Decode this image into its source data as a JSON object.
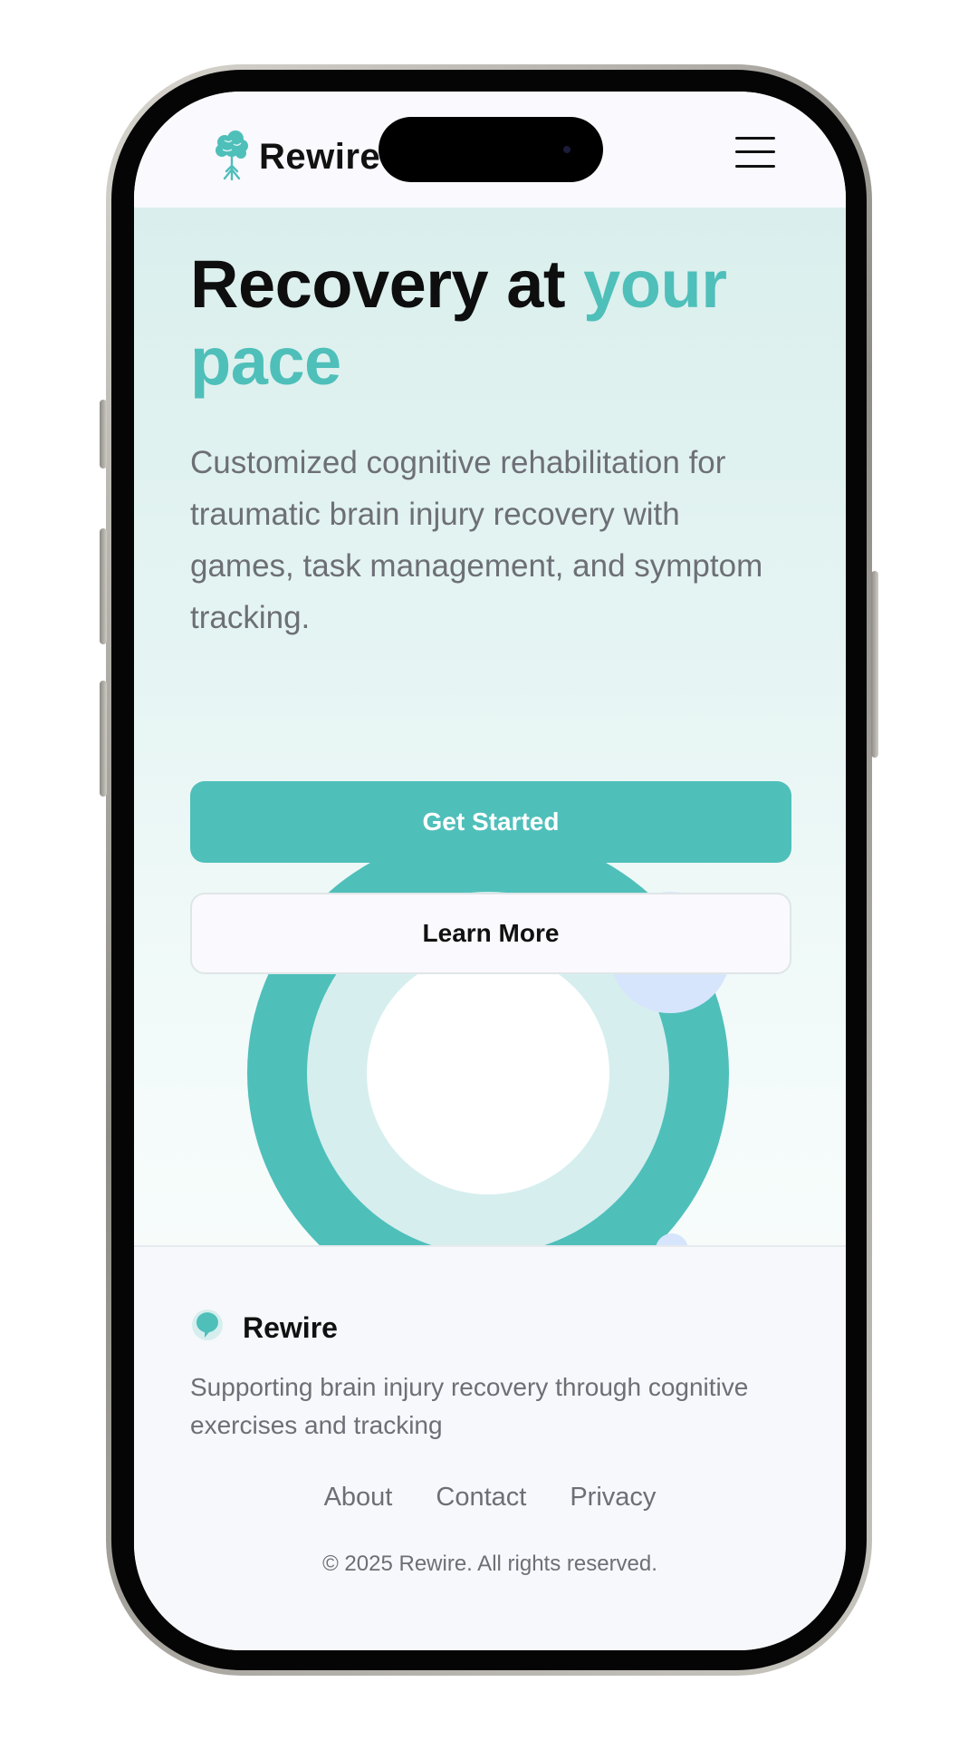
{
  "header": {
    "logo_text": "Rewire",
    "logo_icon": "brain-tree-icon",
    "menu_icon": "hamburger-menu-icon"
  },
  "hero": {
    "title_part1": "Recovery at ",
    "title_accent": "your pace",
    "description": "Customized cognitive rehabilitation for traumatic brain injury recovery with games, task management, and symptom tracking.",
    "primary_button": "Get Started",
    "secondary_button": "Learn More"
  },
  "footer": {
    "brand_name": "Rewire",
    "brand_icon": "speech-bubble-icon",
    "tagline": "Supporting brain injury recovery through cognitive exercises and tracking",
    "links": [
      "About",
      "Contact",
      "Privacy"
    ],
    "copyright": "© 2025 Rewire. All rights reserved."
  },
  "colors": {
    "accent": "#4fbfba",
    "accent_light": "#d6eeee",
    "hero_bg": "#daefed",
    "bubble": "#d6e5fb",
    "text_dark": "#111111",
    "text_muted": "#6d6f76"
  }
}
